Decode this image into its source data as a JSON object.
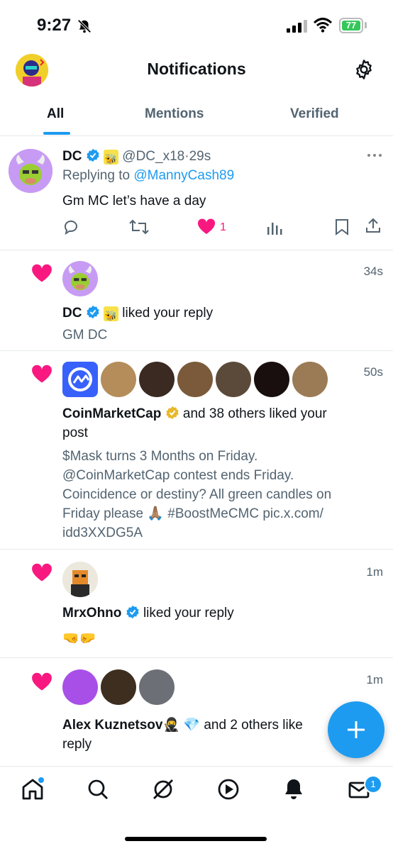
{
  "status": {
    "time": "9:27",
    "battery": "77"
  },
  "header": {
    "title": "Notifications"
  },
  "tabs": [
    {
      "label": "All"
    },
    {
      "label": "Mentions"
    },
    {
      "label": "Verified"
    }
  ],
  "reply_post": {
    "name": "DC",
    "handle": "@DC_x18",
    "sep": "·",
    "time": "29s",
    "replying_prefix": "Replying to",
    "replying_handle": "@MannyCash89",
    "text": "Gm MC let’s have a day",
    "like_count": "1"
  },
  "notifications": [
    {
      "time": "34s",
      "name": "DC",
      "action": "liked your reply",
      "snippet": "GM DC"
    },
    {
      "time": "50s",
      "name": "CoinMarketCap",
      "action": "and 38 others liked your",
      "action2": "post",
      "snippet_lines": [
        "$Mask turns 3 Months on Friday.",
        "@CoinMarketCap contest ends Friday.",
        "Coincidence or destiny? All green candles on",
        "Friday please 🙏🏽 #BoostMeCMC pic.x.com/",
        "idd3XXDG5A"
      ]
    },
    {
      "time": "1m",
      "name": "MrxOhno",
      "action": "liked your reply",
      "snippet": "🤜🤛"
    },
    {
      "time": "1m",
      "name": "Alex Kuznetsov",
      "name_emoji": "🥷 💎",
      "action": "and 2 others like",
      "action2": "reply"
    }
  ],
  "nav": {
    "messages_badge": "1"
  },
  "colors": {
    "accent": "#1d9bf0",
    "like": "#f91880"
  }
}
